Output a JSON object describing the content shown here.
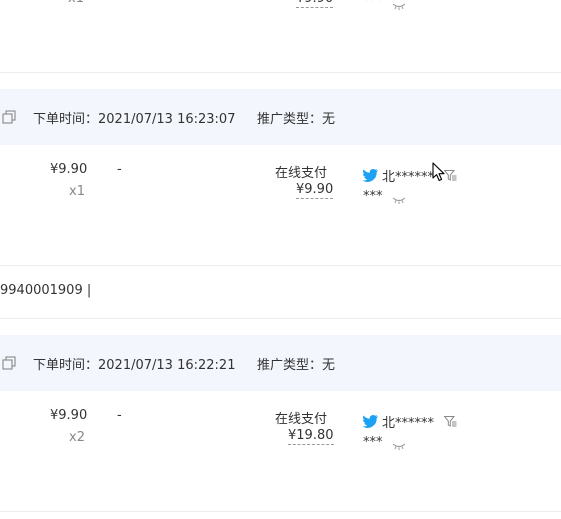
{
  "top_fragment": {
    "qty": "x1",
    "price": "¥9.90",
    "masked": "***"
  },
  "footer_fragment": "9940001909 |",
  "orders": [
    {
      "time_label": "下单时间：",
      "time": "2021/07/13 16:23:07",
      "promo_label": "推广类型：",
      "promo": "无",
      "unit_price": "¥9.90",
      "qty": "x1",
      "discount": "-",
      "pay_method": "在线支付",
      "pay_amount": "¥9.90",
      "buyer_name": "北******",
      "buyer_sub": "***"
    },
    {
      "time_label": "下单时间：",
      "time": "2021/07/13 16:22:21",
      "promo_label": "推广类型：",
      "promo": "无",
      "unit_price": "¥9.90",
      "qty": "x2",
      "discount": "-",
      "pay_method": "在线支付",
      "pay_amount": "¥19.80",
      "buyer_name": "北******",
      "buyer_sub": "***"
    }
  ],
  "icons": {
    "copy": "copy-icon",
    "buyer": "bird-icon",
    "eye": "eye-closed-icon",
    "filter": "filter-icon",
    "cursor": "mouse-cursor-icon"
  },
  "colors": {
    "band": "#f3f6fc",
    "bird": "#1da1f2",
    "divider": "#ececec"
  }
}
